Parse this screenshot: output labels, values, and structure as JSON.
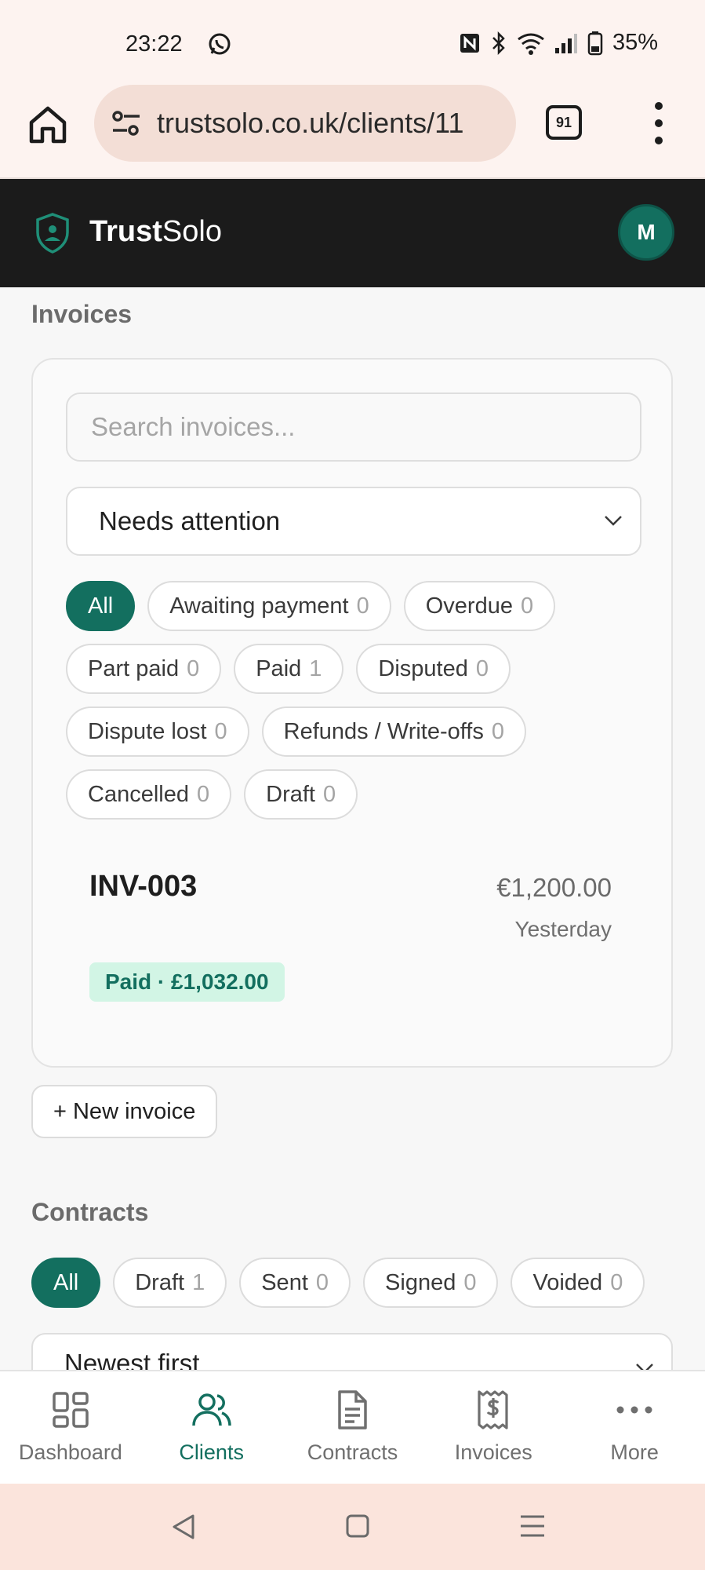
{
  "status_bar": {
    "time": "23:22",
    "battery": "35%"
  },
  "browser": {
    "url": "trustsolo.co.uk/clients/11",
    "tab_count": "91"
  },
  "app": {
    "brand_bold": "Trust",
    "brand_light": "Solo",
    "avatar_initial": "M"
  },
  "invoices": {
    "title": "Invoices",
    "search_placeholder": "Search invoices...",
    "filter_selected": "Needs attention",
    "chips": [
      {
        "label": "All",
        "count": ""
      },
      {
        "label": "Awaiting payment",
        "count": "0"
      },
      {
        "label": "Overdue",
        "count": "0"
      },
      {
        "label": "Part paid",
        "count": "0"
      },
      {
        "label": "Paid",
        "count": "1"
      },
      {
        "label": "Disputed",
        "count": "0"
      },
      {
        "label": "Dispute lost",
        "count": "0"
      },
      {
        "label": "Refunds / Write-offs",
        "count": "0"
      },
      {
        "label": "Cancelled",
        "count": "0"
      },
      {
        "label": "Draft",
        "count": "0"
      }
    ],
    "items": [
      {
        "id": "INV-003",
        "amount": "€1,200.00",
        "date": "Yesterday",
        "badge": "Paid · £1,032.00"
      }
    ],
    "new_button": "+ New invoice"
  },
  "contracts": {
    "title": "Contracts",
    "chips": [
      {
        "label": "All",
        "count": ""
      },
      {
        "label": "Draft",
        "count": "1"
      },
      {
        "label": "Sent",
        "count": "0"
      },
      {
        "label": "Signed",
        "count": "0"
      },
      {
        "label": "Voided",
        "count": "0"
      }
    ],
    "sort_selected": "Newest first"
  },
  "bottom_nav": [
    {
      "label": "Dashboard",
      "icon": "grid-icon"
    },
    {
      "label": "Clients",
      "icon": "users-icon"
    },
    {
      "label": "Contracts",
      "icon": "document-icon"
    },
    {
      "label": "Invoices",
      "icon": "receipt-icon"
    },
    {
      "label": "More",
      "icon": "more-dots-icon"
    }
  ],
  "colors": {
    "accent": "#136f5f",
    "header_bg": "#1b1b1b",
    "badge_bg": "#d2f5e5"
  }
}
